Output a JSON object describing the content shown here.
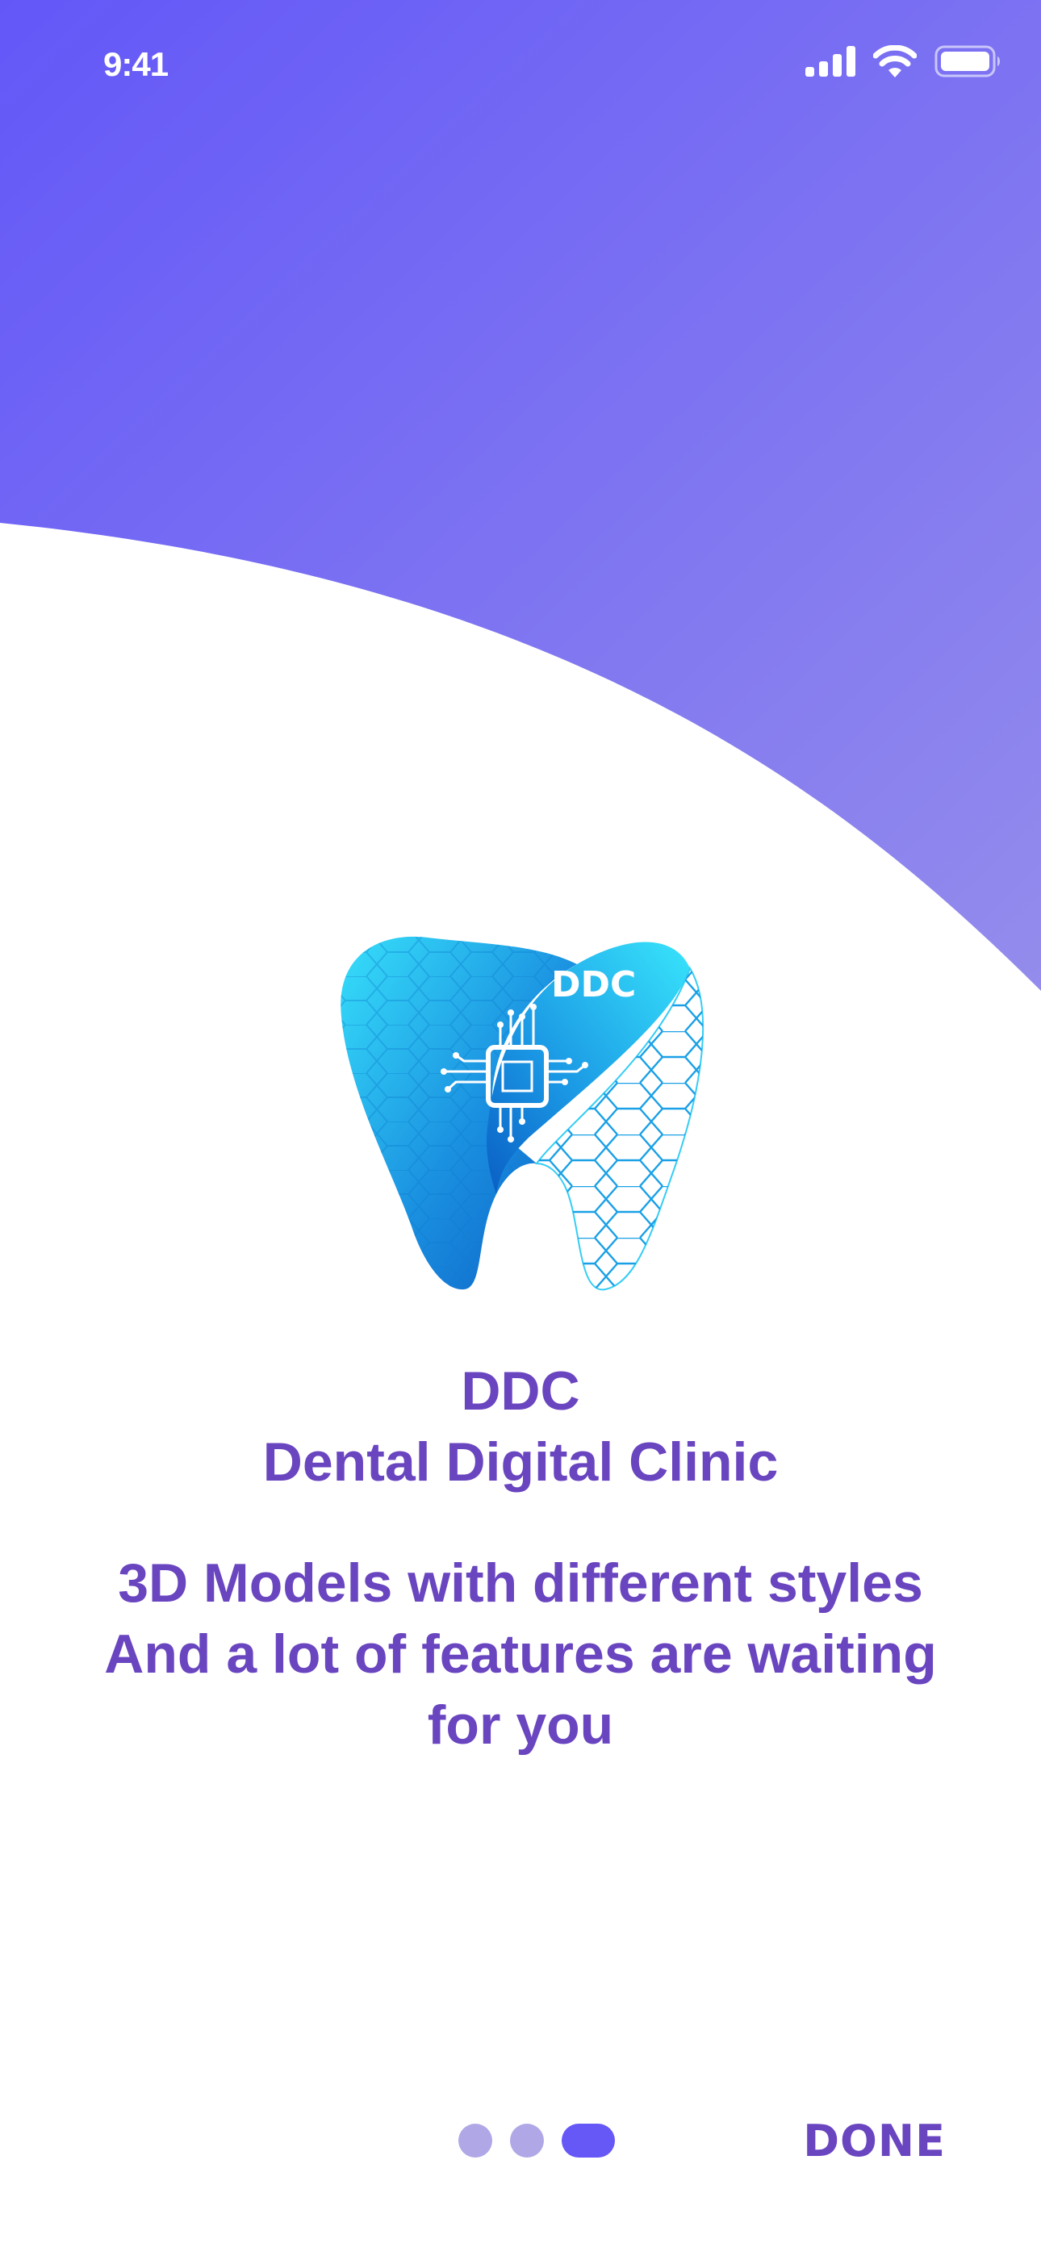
{
  "status_bar": {
    "time": "9:41",
    "icons": [
      "cellular-signal-icon",
      "wifi-icon",
      "battery-icon"
    ]
  },
  "logo": {
    "text": "DDC",
    "icon": "tooth-chip-logo"
  },
  "title": {
    "short": "DDC",
    "full": "Dental Digital Clinic"
  },
  "description": {
    "lines": [
      "3D Models with different styles",
      "And a lot of features are waiting",
      "for you"
    ]
  },
  "pager": {
    "total": 3,
    "active_index": 2
  },
  "actions": {
    "done_label": "DONE"
  },
  "colors": {
    "gradient_start": "#6357f8",
    "gradient_end": "#9189ea",
    "text_primary": "#6a45c0",
    "dot_inactive": "#b0a8e6",
    "dot_active": "#6657f7",
    "logo_blue": "#1e9be8",
    "logo_cyan": "#38e0fb"
  }
}
